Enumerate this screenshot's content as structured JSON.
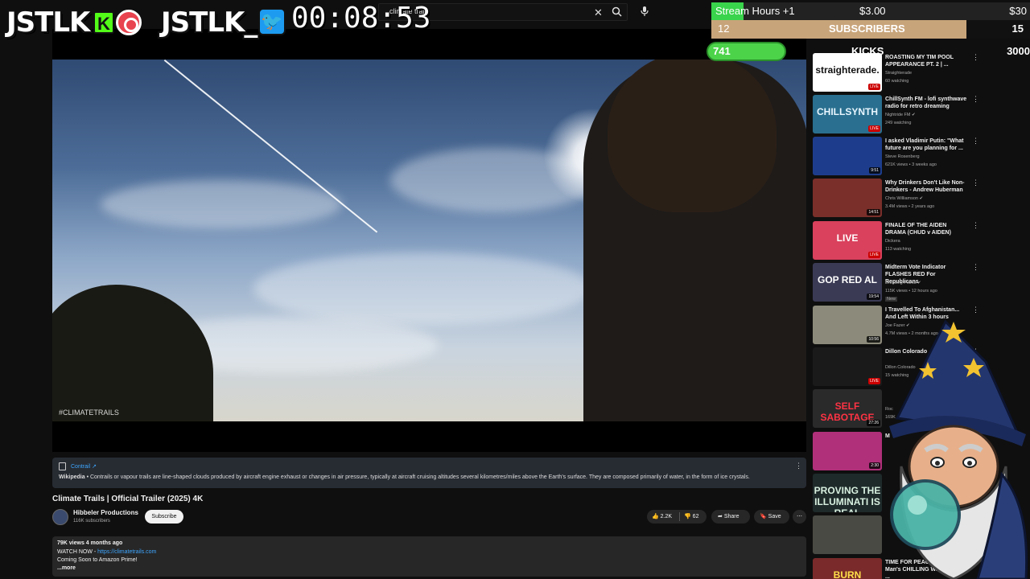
{
  "search": {
    "query": "climate trail"
  },
  "overlay": {
    "logo1": "JSTLK",
    "logo2": "JSTLK_",
    "timer": "00:08:53",
    "stream_hours": {
      "label": "Stream Hours +1",
      "amount": "$3.00",
      "goal": "$30",
      "progress": 0.1
    },
    "subscribers": {
      "current": "12",
      "label": "SUBSCRIBERS",
      "goal": "15",
      "progress": 0.8
    },
    "kicks": {
      "current": "741",
      "label": "KICKS",
      "goal": "3000",
      "progress": 0.247
    }
  },
  "video": {
    "hashtag": "#CLIMATETRAILS",
    "wiki": {
      "topic": "Contrail ↗",
      "source": "Wikipedia",
      "text": "• Contrails or vapour trails are line-shaped clouds produced by aircraft engine exhaust or changes in air pressure, typically at aircraft cruising altitudes several kilometres/miles above the Earth's surface. They are composed primarily of water, in the form of ice crystals."
    },
    "title": "Climate Trails | Official Trailer (2025) 4K",
    "channel": {
      "name": "Hibbeler Productions",
      "subs": "116K subscribers",
      "subscribe_label": "Subscribe"
    },
    "actions": {
      "likes": "2.2K",
      "dislikes": "62",
      "share": "Share",
      "save": "Save",
      "more": "⋯"
    },
    "description": {
      "meta": "79K views  4 months ago",
      "line1_prefix": "WATCH NOW - ",
      "line1_link": "https://climatetrails.com",
      "line2": "Coming Soon to Amazon Prime!",
      "more": "...more"
    }
  },
  "sidebar": {
    "items": [
      {
        "title": "ROASTING MY TIM POOL APPEARANCE PT. 2 | ...",
        "channel": "Straighterade",
        "meta": "60 watching",
        "badge": "LIVE",
        "thumb_text": "straighterade.",
        "color": "#ffffff",
        "text_color": "#111111"
      },
      {
        "title": "ChillSynth FM - lofi synthwave radio for retro dreaming",
        "channel": "Nightride FM ✔",
        "meta": "249 watching",
        "badge": "LIVE",
        "thumb_text": "CHILLSYNTH",
        "color": "#2a6f8f",
        "text_color": "#e8f6ff"
      },
      {
        "title": "I asked Vladimir Putin: \"What future are you planning for ...",
        "channel": "Steve Rosenberg",
        "meta": "621K views • 3 weeks ago",
        "badge": "9:51",
        "thumb_text": "",
        "color": "#1d3d8c",
        "text_color": "#ffffff"
      },
      {
        "title": "Why Drinkers Don't Like Non-Drinkers - Andrew Huberman",
        "channel": "Chris Williamson ✔",
        "meta": "3.4M views • 2 years ago",
        "badge": "14:51",
        "thumb_text": "",
        "color": "#7a2f2a",
        "text_color": "#ffffff"
      },
      {
        "title": "FINALE OF THE AIDEN DRAMA (CHUD v AIDEN)",
        "channel": "Dickera",
        "meta": "113 watching",
        "badge": "LIVE",
        "thumb_text": "LIVE",
        "color": "#d9415c",
        "text_color": "#ffffff"
      },
      {
        "title": "Midterm Vote Indicator FLASHES RED For Republicans",
        "channel": "Breaking Points ✔",
        "meta": "115K views • 12 hours ago",
        "badge": "19:54",
        "thumb_text": "GOP RED AL",
        "color": "#3a3a55",
        "text_color": "#ffffff",
        "extra": "New"
      },
      {
        "title": "I Travelled To Afghanistan... And Left Within 3 hours",
        "channel": "Joe Fazer ✔",
        "meta": "4.7M views • 2 months ago",
        "badge": "10:56",
        "thumb_text": "",
        "color": "#8c8a7a",
        "text_color": "#ffffff"
      },
      {
        "title": "Dillon Colorado",
        "channel": "Dillon Colorado",
        "meta": "15 watching",
        "badge": "LIVE",
        "thumb_text": "",
        "color": "#1a1a1a",
        "text_color": "#ffffff"
      },
      {
        "title": "",
        "channel": "Roc",
        "meta": "169K",
        "badge": "27:26",
        "thumb_text": "SELF SABOTAGE",
        "color": "#2a2a2a",
        "text_color": "#ff3344"
      },
      {
        "title": "M",
        "channel": "",
        "meta": "",
        "badge": "2:30",
        "thumb_text": "",
        "color": "#b0307a",
        "text_color": "#ffffff"
      },
      {
        "title": "",
        "channel": "",
        "meta": "",
        "badge": "",
        "thumb_text": "PROVING THE ILLUMINATI IS REAL",
        "color": "#1e2a2a",
        "text_color": "#d8f0e0"
      },
      {
        "title": "",
        "channel": "",
        "meta": "",
        "badge": "",
        "thumb_text": "",
        "color": "#4a4a44",
        "text_color": "#ffffff"
      },
      {
        "title": "TIME FOR PEACE IS OVER : Man's CHILLING Warning For ...",
        "channel": "",
        "meta": "",
        "badge": "",
        "thumb_text": "BURN WARNING",
        "color": "#7a2a2a",
        "text_color": "#ffe04a"
      }
    ]
  }
}
